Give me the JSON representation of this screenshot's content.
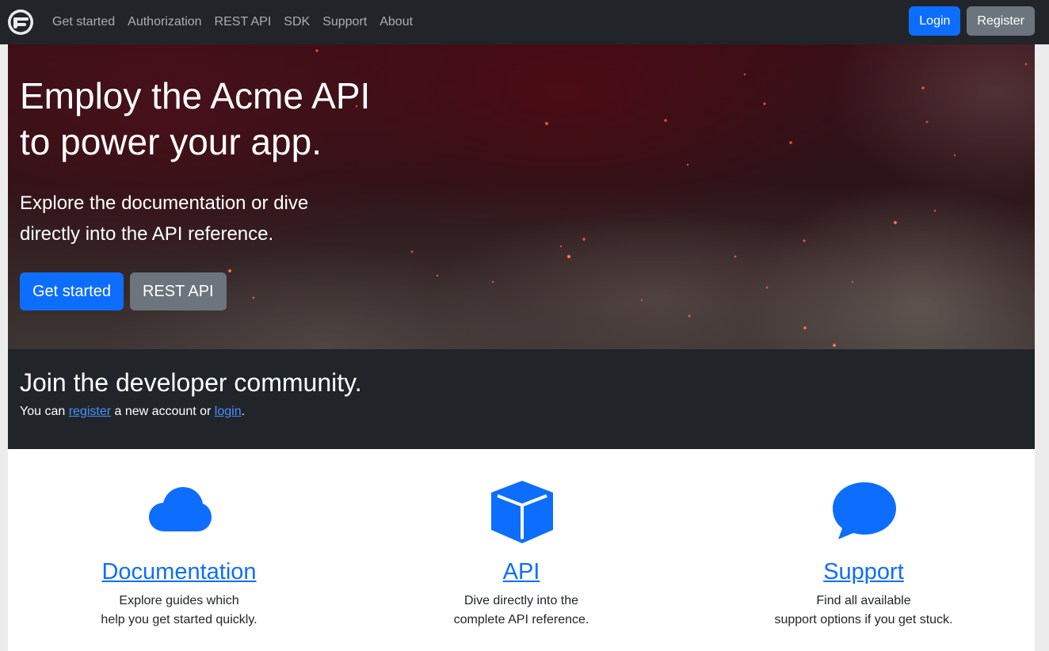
{
  "nav": {
    "links": [
      "Get started",
      "Authorization",
      "REST API",
      "SDK",
      "Support",
      "About"
    ],
    "login_label": "Login",
    "register_label": "Register"
  },
  "hero": {
    "title_line1": "Employ the Acme API",
    "title_line2": "to power your app.",
    "lead_line1": "Explore the documentation or dive",
    "lead_line2": "directly into the API reference.",
    "primary_button": "Get started",
    "secondary_button": "REST API"
  },
  "community": {
    "heading": "Join the developer community.",
    "text_before": "You can ",
    "register_link": "register",
    "text_middle": " a new account or ",
    "login_link": "login",
    "text_after": "."
  },
  "features": [
    {
      "icon": "cloud-icon",
      "title": "Documentation",
      "desc_line1": "Explore guides which",
      "desc_line2": "help you get started quickly."
    },
    {
      "icon": "box-icon",
      "title": "API",
      "desc_line1": "Dive directly into the",
      "desc_line2": "complete API reference."
    },
    {
      "icon": "chat-bubble-icon",
      "title": "Support",
      "desc_line1": "Find all available",
      "desc_line2": "support options if you get stuck."
    }
  ],
  "colors": {
    "navbar_bg": "#212529",
    "primary": "#0d6efd",
    "secondary": "#6c757d",
    "link": "#0d6efd"
  }
}
